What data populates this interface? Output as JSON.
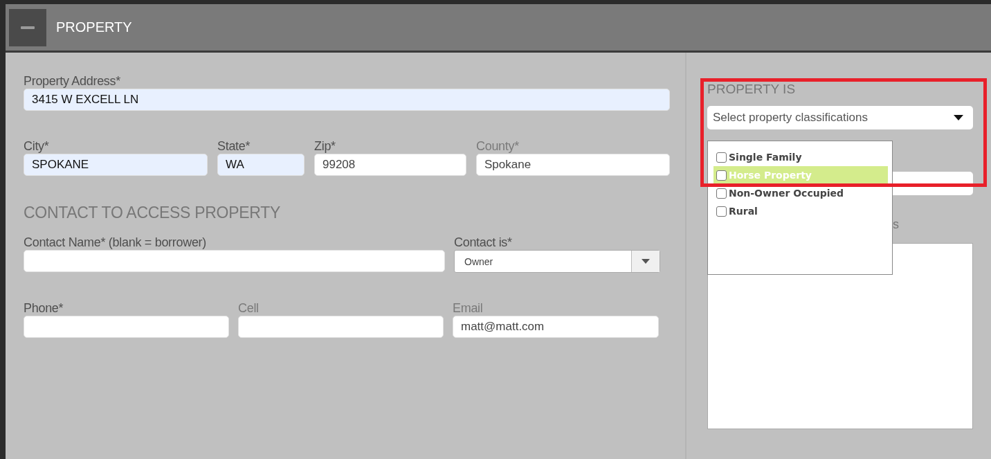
{
  "header": {
    "title": "PROPERTY"
  },
  "property": {
    "rows": [
      {
        "fields": [
          {
            "kind": "text",
            "label": "Property Address*",
            "value": "3415 W EXCELL LN",
            "autofilled": true,
            "label_dim": false
          }
        ]
      },
      {
        "fields": [
          {
            "kind": "text",
            "label": "City*",
            "value": "SPOKANE",
            "autofilled": true,
            "label_dim": false
          },
          {
            "kind": "text",
            "label": "State*",
            "value": "WA",
            "autofilled": true,
            "label_dim": false
          },
          {
            "kind": "text",
            "label": "Zip*",
            "value": "99208",
            "autofilled": false,
            "label_dim": false
          },
          {
            "kind": "text",
            "label": "County*",
            "value": "Spokane",
            "autofilled": false,
            "label_dim": true
          }
        ]
      }
    ]
  },
  "contact": {
    "heading": "CONTACT TO ACCESS PROPERTY",
    "rows": [
      {
        "fields": [
          {
            "kind": "text",
            "label": "Contact Name* (blank = borrower)",
            "label_dim": false
          },
          {
            "kind": "select",
            "label": "Contact is*",
            "value": "Owner",
            "label_dim": false
          }
        ]
      },
      {
        "fields": [
          {
            "kind": "text",
            "label": "Phone*",
            "label_dim": false
          },
          {
            "kind": "text",
            "label": "Cell",
            "label_dim": true
          },
          {
            "kind": "text",
            "label": "Email",
            "value": "matt@matt.com",
            "label_dim": true
          }
        ]
      }
    ]
  },
  "property_is": {
    "heading": "PROPERTY IS",
    "select": {
      "placeholder": "Select property classifications"
    },
    "options": [
      {
        "label": "Single Family",
        "checked": false,
        "selected": false
      },
      {
        "label": "Horse Property",
        "checked": false,
        "selected": true
      },
      {
        "label": "Non-Owner Occupied",
        "checked": false,
        "selected": false
      },
      {
        "label": "Rural",
        "checked": false,
        "selected": false
      }
    ],
    "label_tail": "s"
  }
}
